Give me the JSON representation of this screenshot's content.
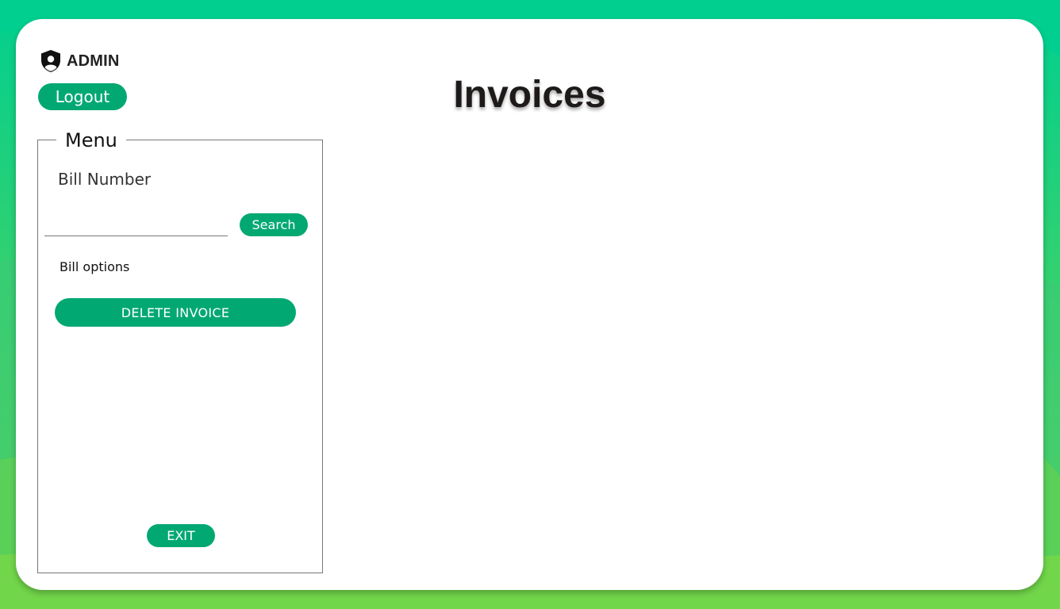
{
  "header": {
    "role_label": "ADMIN",
    "logout_label": "Logout",
    "page_title": "Invoices"
  },
  "menu": {
    "legend": "Menu",
    "bill_number_label": "Bill Number",
    "bill_number_value": "",
    "search_label": "Search",
    "bill_options_label": "Bill options",
    "delete_invoice_label": "DELETE INVOICE",
    "exit_label": "EXIT"
  },
  "icons": {
    "admin": "shield-user-icon"
  },
  "colors": {
    "accent": "#02a872",
    "background_top": "#00cf8f",
    "background_bottom": "#6fd44b"
  }
}
